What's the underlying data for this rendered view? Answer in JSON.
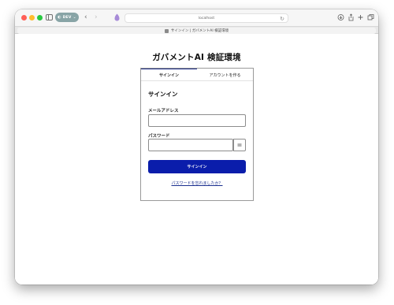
{
  "browser": {
    "dev_badge": "DEV",
    "url": "localhost",
    "tab_title": "サインイン | ガバメントAI 検証環境"
  },
  "page": {
    "title": "ガバメントAI 検証環境"
  },
  "tabs": [
    {
      "label": "サインイン",
      "active": true
    },
    {
      "label": "アカウントを作る",
      "active": false
    }
  ],
  "form": {
    "heading": "サインイン",
    "email_label": "メールアドレス",
    "email_value": "",
    "password_label": "パスワード",
    "password_value": "",
    "submit_label": "サインイン",
    "forgot_link": "パスワードを忘れましたか？"
  },
  "icons": {
    "window_controls": [
      "close-icon",
      "minimize-icon",
      "zoom-icon"
    ],
    "toolbar": [
      "sidebar-icon",
      "back-icon",
      "forward-icon",
      "extension-icon",
      "reload-icon",
      "download-icon",
      "share-icon",
      "new-tab-icon",
      "tab-overview-icon"
    ],
    "password_toggle": "show-password-icon"
  },
  "colors": {
    "primary_button": "#0a1dab",
    "link": "#1a2f8f",
    "active_tab_indicator": "#1b2a87",
    "dev_badge": "#88a4a6"
  }
}
